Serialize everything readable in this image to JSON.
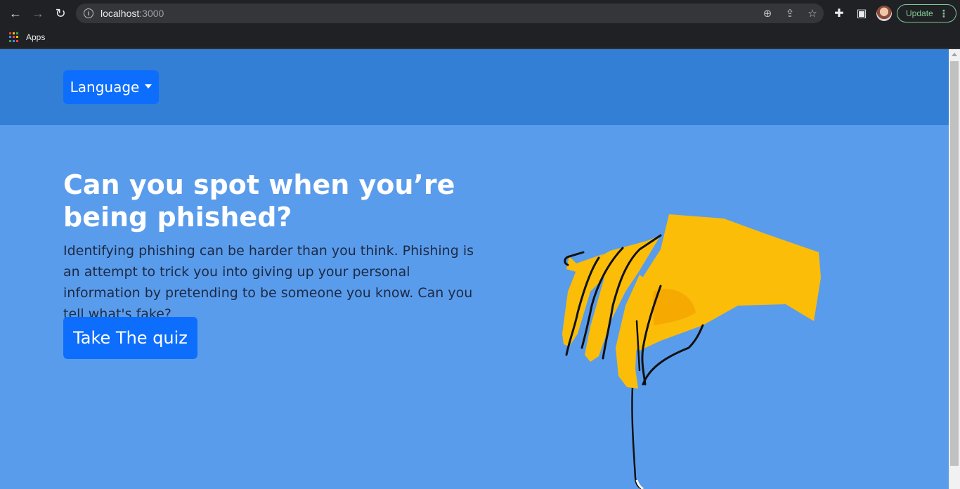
{
  "browser": {
    "url_host": "localhost",
    "url_port": ":3000",
    "update_label": "Update",
    "bookmarks": [
      {
        "label": "Apps"
      }
    ],
    "icons": [
      "back-icon",
      "forward-icon",
      "reload-icon",
      "info-icon",
      "zoom-icon",
      "share-icon",
      "star-icon",
      "extensions-icon",
      "side-panel-icon",
      "profile-avatar",
      "more-icon"
    ]
  },
  "header": {
    "language_label": "Language"
  },
  "hero": {
    "title": "Can you spot when you’re being phished?",
    "description": "Identifying phishing can be harder than you think. Phishing is an attempt to trick you into giving up your personal information by pretending to be someone you know. Can you tell what's fake?",
    "cta_label": "Take The quiz"
  },
  "colors": {
    "page_background": "#5a9cec",
    "header_band": "#337fd6",
    "primary_button": "#0d6efd",
    "hand": "#fbbd08"
  }
}
